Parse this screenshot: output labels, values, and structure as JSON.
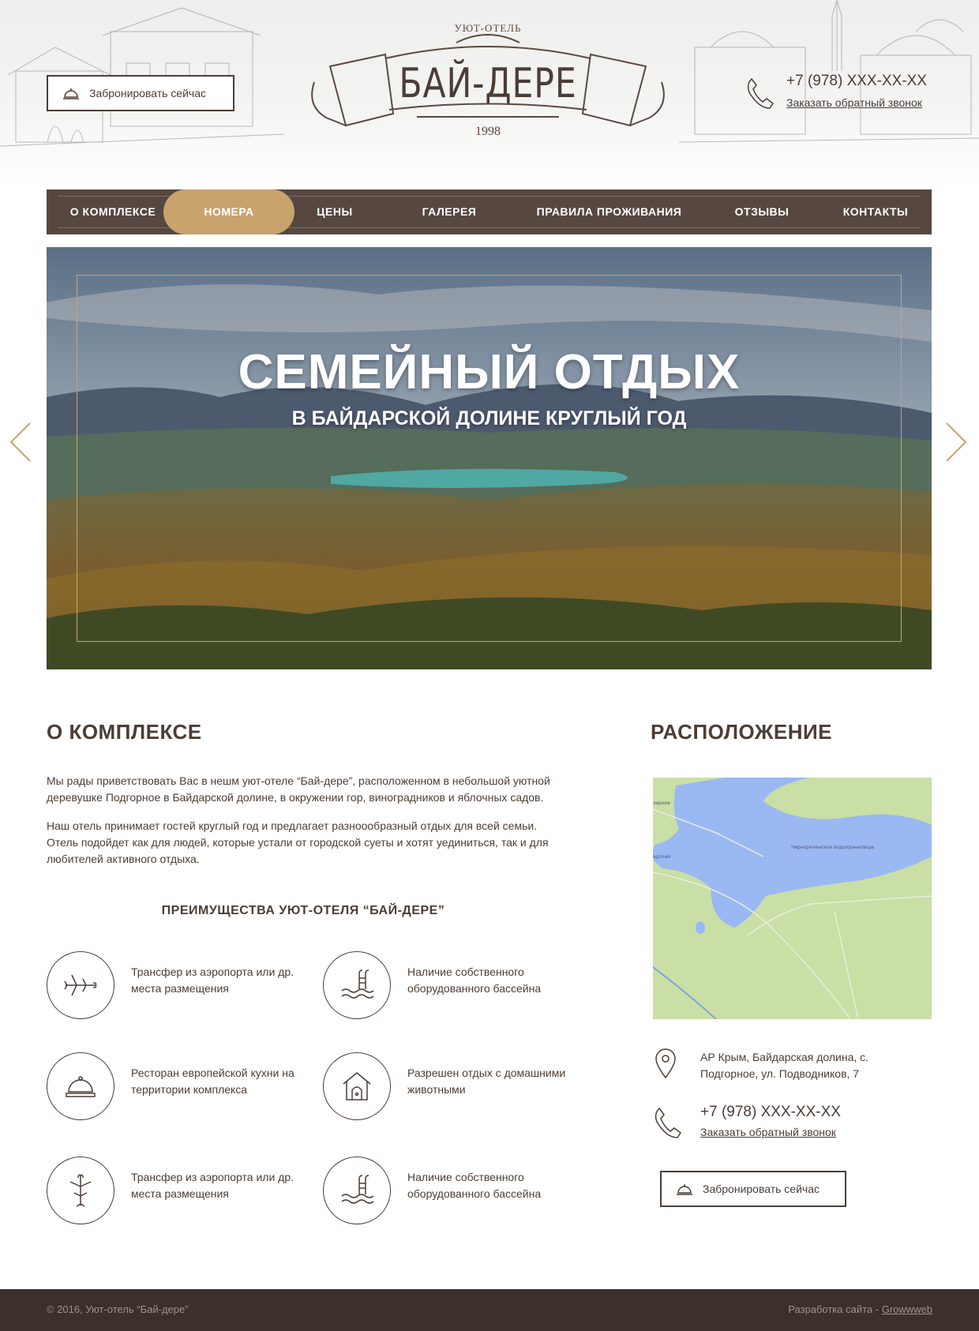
{
  "header": {
    "book_label": "Забронировать сейчас",
    "logo": {
      "subtitle": "УЮТ-ОТЕЛЬ",
      "name": "БАЙ-ДЕРЕ",
      "year": "1998"
    },
    "phone": "+7 (978) XXX-XX-XX",
    "callback_label": "Заказать обратный звонок"
  },
  "nav": {
    "items": [
      {
        "label": "О КОМПЛЕКСЕ"
      },
      {
        "label": "НОМЕРА",
        "active": true
      },
      {
        "label": "ЦЕНЫ"
      },
      {
        "label": "ГАЛЕРЕЯ"
      },
      {
        "label": "ПРАВИЛА ПРОЖИВАНИЯ"
      },
      {
        "label": "ОТЗЫВЫ"
      },
      {
        "label": "КОНТАКТЫ"
      }
    ]
  },
  "hero": {
    "title": "СЕМЕЙНЫЙ ОТДЫХ",
    "subtitle": "В БАЙДАРСКОЙ ДОЛИНЕ КРУГЛЫЙ ГОД",
    "prev_icon": "chevron-left-icon",
    "next_icon": "chevron-right-icon"
  },
  "about": {
    "title": "О КОМПЛЕКСЕ",
    "p1": "Мы рады приветствовать Вас в нешм уют-отеле “Бай-дере”, расположенном в небольшой уютной деревушке Подгорное в Байдарской долине, в окружении гор, виноградников и яблочных садов.",
    "p2": "Наш отель принимает гостей круглый год и предлагает разноообразный отдых для всей семьи. Отель подойдет как для людей, которые устали от городской суеты и хотят уединиться, так и для любителей активного отдыха.",
    "advantages_title": "ПРЕИМУЩЕСТВА УЮТ-ОТЕЛЯ “БАЙ-ДЕРЕ”",
    "features": [
      {
        "icon": "airplane-icon",
        "text": "Трансфер из аэропорта или др. места размещения"
      },
      {
        "icon": "pool-icon",
        "text": "Наличие собственного оборудованного бассейна"
      },
      {
        "icon": "cloche-icon",
        "text": "Ресторан европейской кухни на территории комплекса"
      },
      {
        "icon": "pet-house-icon",
        "text": "Разрешен отдых с домашними животными"
      },
      {
        "icon": "airplane-icon",
        "text": "Трансфер из аэропорта или др. места размещения"
      },
      {
        "icon": "pool-icon",
        "text": "Наличие собственного оборудованного бассейна"
      }
    ]
  },
  "location": {
    "title": "РАСПОЛОЖЕНИЕ",
    "map": {
      "lake_label": "Чернореченское водохранилище",
      "label_left_top": "зерное",
      "label_left_mid": "арский"
    },
    "address": "АР Крым, Байдарская долина, с. Подгорное, ул. Подводников, 7",
    "phone": "+7 (978) XXX-XX-XX",
    "callback_label": "Заказать обратный звонок",
    "book_label": "Забронировать сейчас"
  },
  "footer": {
    "copyright": "© 2016, Уют-отель “Бай-дере”",
    "dev_prefix": "Разработка сайта - ",
    "dev_link": "Growwweb"
  },
  "colors": {
    "brown": "#564840",
    "gold": "#c9a36d",
    "dark": "#3b302b",
    "text": "#4b3d36"
  }
}
